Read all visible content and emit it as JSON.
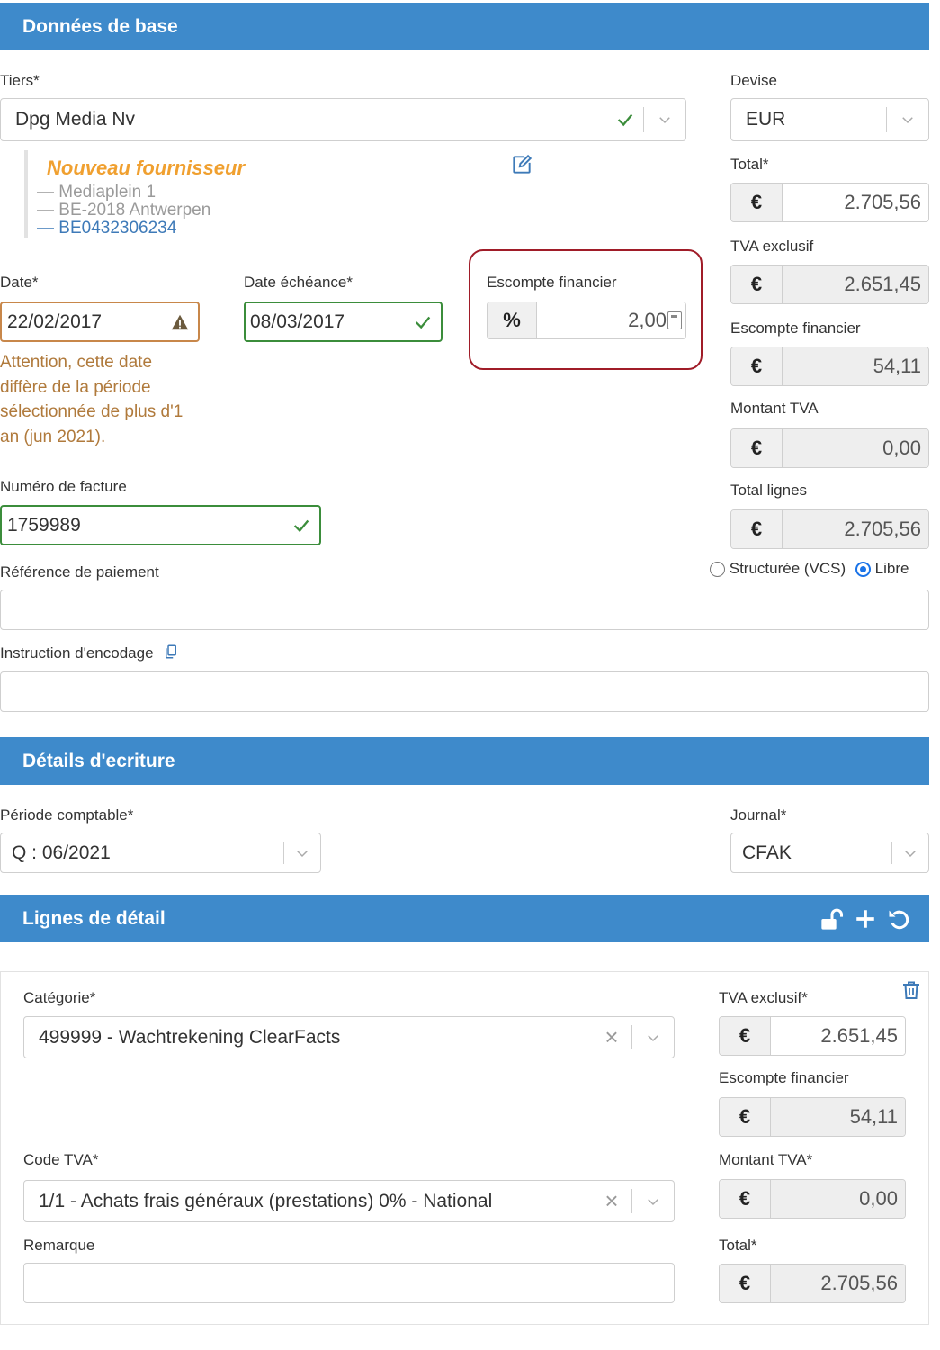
{
  "colors": {
    "banner": "#3e8acb",
    "supplier_name": "#f0a030",
    "vat_link": "#3e7ab8",
    "warning_text": "#b07a3c",
    "valid_border": "#3b8d3b",
    "highlight_box": "#a01c28"
  },
  "basic": {
    "title": "Données de base",
    "tiers_label": "Tiers*",
    "tiers_value": "Dpg Media Nv",
    "supplier": {
      "name": "Nouveau fournisseur",
      "line1": "— Mediaplein 1",
      "line2": "— BE-2018 Antwerpen",
      "vat": "— BE0432306234"
    },
    "date_label": "Date*",
    "date_value": "22/02/2017",
    "date_warning": [
      "Attention, cette date",
      "diffère de la période",
      "sélectionnée de plus d'1",
      "an (jun 2021)."
    ],
    "due_label": "Date échéance*",
    "due_value": "08/03/2017",
    "discount_label": "Escompte financier",
    "discount_unit": "%",
    "discount_value": "2,00",
    "invoice_label": "Numéro de facture",
    "invoice_value": "1759989",
    "payref_label": "Référence de paiement",
    "payref_value": "",
    "radio_structured": "Structurée (VCS)",
    "radio_free": "Libre",
    "instruction_label": "Instruction d'encodage",
    "instruction_value": "",
    "devise_label": "Devise",
    "devise_value": "EUR",
    "currency_symbol": "€",
    "totals": [
      {
        "label": "Total*",
        "value": "2.705,56"
      },
      {
        "label": "TVA exclusif",
        "value": "2.651,45"
      },
      {
        "label": "Escompte financier",
        "value": "54,11"
      },
      {
        "label": "Montant TVA",
        "value": "0,00"
      },
      {
        "label": "Total lignes",
        "value": "2.705,56"
      }
    ]
  },
  "entry": {
    "title": "Détails d'ecriture",
    "period_label": "Période comptable*",
    "period_value": "Q : 06/2021",
    "journal_label": "Journal*",
    "journal_value": "CFAK"
  },
  "lines": {
    "title": "Lignes de détail",
    "category_label": "Catégorie*",
    "category_value": "499999 - Wachtrekening ClearFacts",
    "vat_code_label": "Code TVA*",
    "vat_code_value": "1/1 - Achats frais généraux (prestations) 0% - National",
    "remark_label": "Remarque",
    "remark_value": "",
    "amounts": [
      {
        "label": "TVA exclusif*",
        "value": "2.651,45"
      },
      {
        "label": "Escompte financier",
        "value": "54,11"
      },
      {
        "label": "Montant TVA*",
        "value": "0,00"
      },
      {
        "label": "Total*",
        "value": "2.705,56"
      }
    ]
  }
}
